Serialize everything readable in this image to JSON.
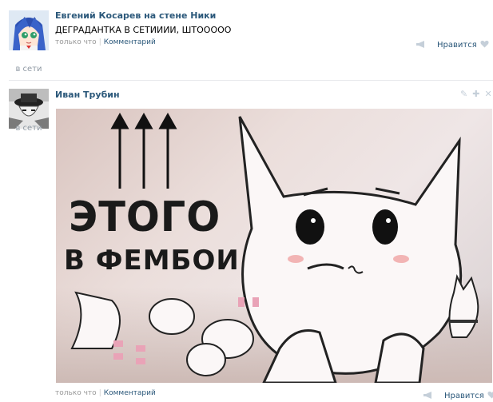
{
  "post1": {
    "author": "Евгений Косарев на стене Ники",
    "text": "ДЕГРАДАНТКА В СЕТИИИИ, ШТООООО",
    "time": "только что",
    "comment_label": "Комментарий",
    "like_label": "Нравится",
    "status": "в сети"
  },
  "post2": {
    "author": "Иван Трубин",
    "image_caption_line1": "ЭТОГО",
    "image_caption_line2": "В ФЕМБОИ",
    "time": "только что",
    "comment_label": "Комментарий",
    "like_label": "Нравится",
    "status": "в сети"
  },
  "colors": {
    "link": "#2b587a",
    "meta": "#999999",
    "icon": "#c5cfd9"
  },
  "icons": [
    "avatar-anime",
    "avatar-manga",
    "megaphone-icon",
    "heart-icon",
    "edit-icon",
    "pin-icon",
    "close-icon",
    "arrow-up-icon"
  ]
}
